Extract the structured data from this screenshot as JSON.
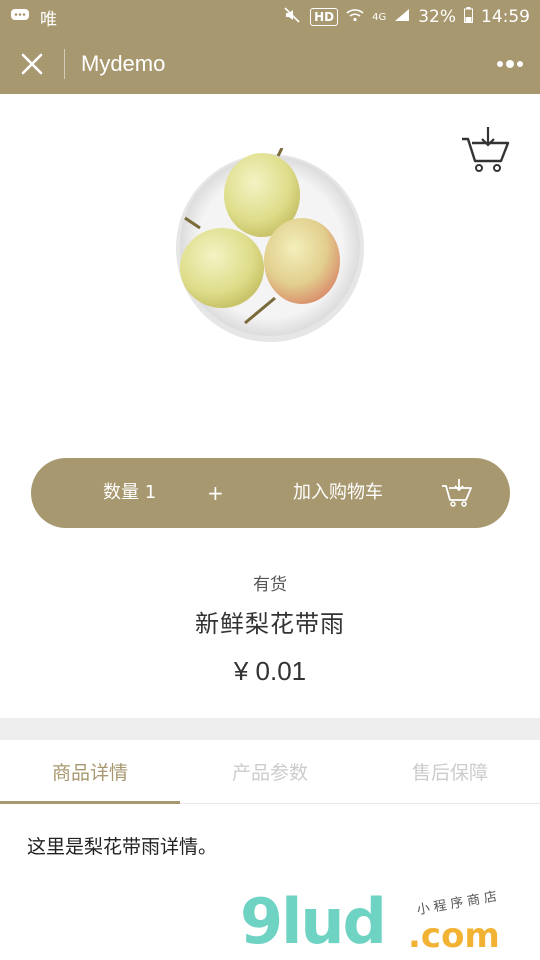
{
  "status_bar": {
    "carrier": "唯",
    "hd_badge": "HD",
    "network": "4G",
    "battery": "32%",
    "time": "14:59"
  },
  "navbar": {
    "title": "Mydemo"
  },
  "product": {
    "image": "pears-on-plate",
    "stock_status": "有货",
    "name": "新鲜梨花带雨",
    "price": "¥ 0.01"
  },
  "action_bar": {
    "quantity_label": "数量 1",
    "plus_label": "+",
    "add_to_cart_label": "加入购物车"
  },
  "tabs": [
    {
      "label": "商品详情",
      "active": true
    },
    {
      "label": "产品参数",
      "active": false
    },
    {
      "label": "售后保障",
      "active": false
    }
  ],
  "detail": {
    "text": "这里是梨花带雨详情。"
  },
  "watermark": {
    "main": "9lud",
    "suffix": ".com",
    "subtitle": "小程序商店"
  },
  "colors": {
    "brand": "#a89870",
    "tab_inactive": "#cccccc",
    "watermark_teal": "#6fd3c4",
    "watermark_orange": "#f2b233"
  }
}
